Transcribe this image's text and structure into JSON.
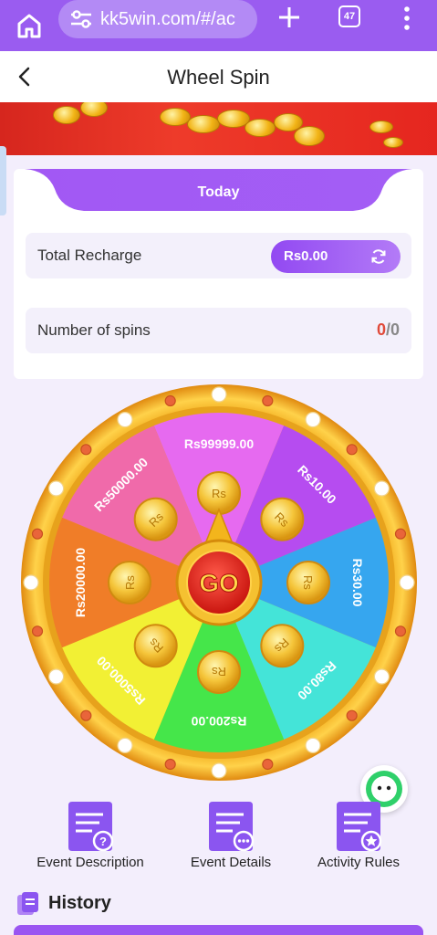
{
  "browser": {
    "url": "kk5win.com/#/ac",
    "tab_count": "47"
  },
  "header": {
    "title": "Wheel Spin"
  },
  "card": {
    "tab_label": "Today",
    "total_recharge_label": "Total Recharge",
    "total_recharge_value": "Rs0.00",
    "spins_label": "Number of spins",
    "spins_used": "0",
    "spins_sep": "/",
    "spins_total": "0"
  },
  "wheel": {
    "center_label": "GO",
    "coin_label": "Rs",
    "segments": [
      {
        "label": "Rs99999.00",
        "color": "#e66af0"
      },
      {
        "label": "Rs10.00",
        "color": "#b64cf0"
      },
      {
        "label": "Rs30.00",
        "color": "#36a6ef"
      },
      {
        "label": "Rs80.00",
        "color": "#44e4d8"
      },
      {
        "label": "Rs200.00",
        "color": "#45e64a"
      },
      {
        "label": "Rs5000.00",
        "color": "#f2f034"
      },
      {
        "label": "Rs20000.00",
        "color": "#f07d28"
      },
      {
        "label": "Rs50000.00",
        "color": "#f06aaa"
      }
    ]
  },
  "actions": [
    {
      "label": "Event Description",
      "icon": "document-question-icon"
    },
    {
      "label": "Event Details",
      "icon": "document-more-icon"
    },
    {
      "label": "Activity Rules",
      "icon": "document-star-icon"
    }
  ],
  "history": {
    "label": "History"
  },
  "colors": {
    "brand": "#9a5cf0",
    "accent": "#a35cf3",
    "page_bg": "#f3eefc",
    "danger": "#e04a3a"
  }
}
